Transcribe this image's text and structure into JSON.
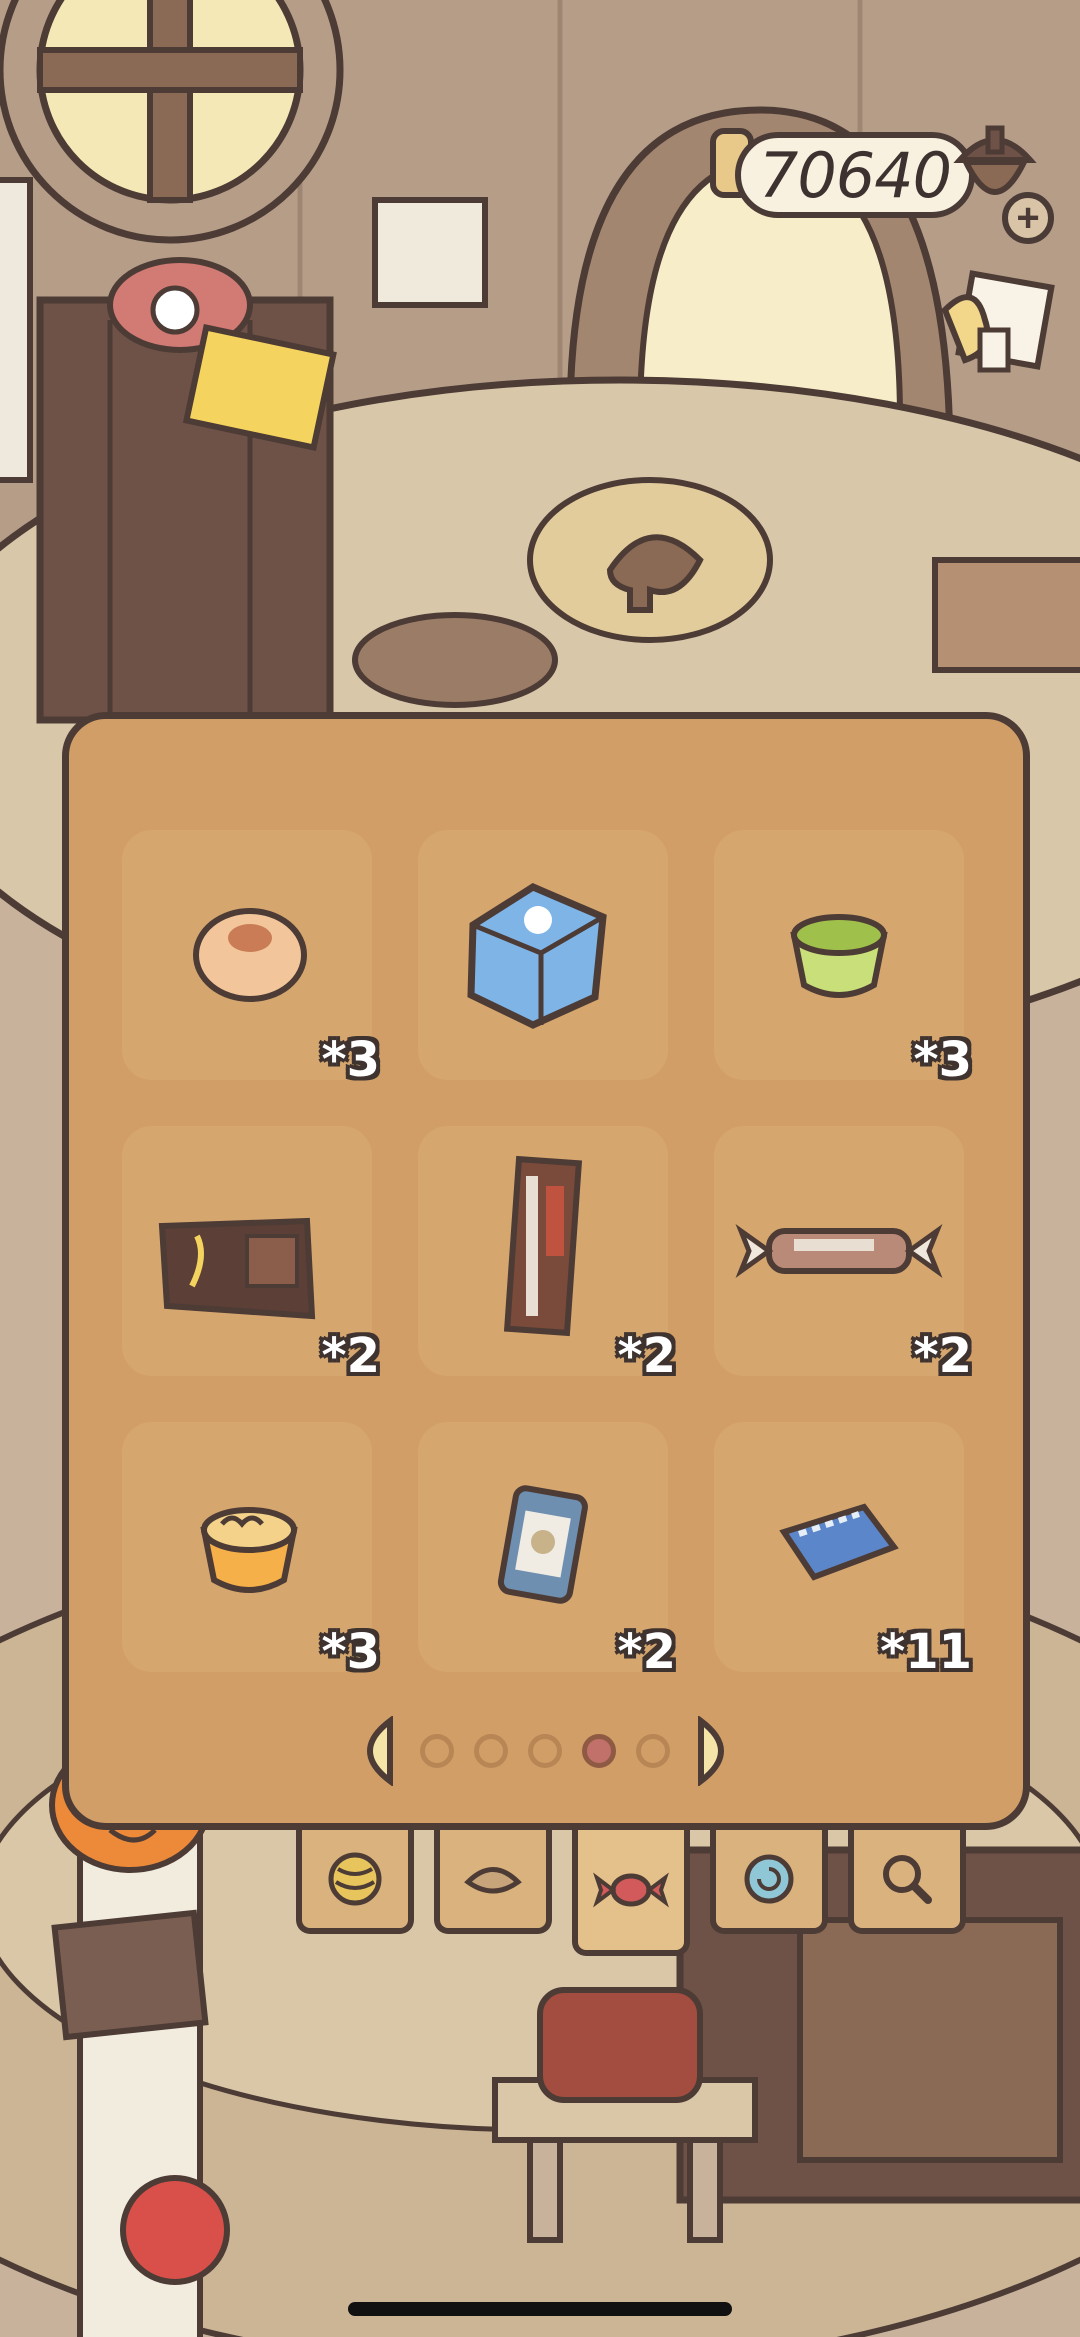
{
  "header": {
    "coins": "70640",
    "add_coins_icon": "plus-icon",
    "task_icon": "clipboard-icon"
  },
  "inventory": {
    "items": [
      {
        "name": "bun-icon",
        "count": "*3"
      },
      {
        "name": "blue-candy-box-icon",
        "count": ""
      },
      {
        "name": "green-jelly-cup-icon",
        "count": "*3"
      },
      {
        "name": "chocolate-bar-icon",
        "count": "*2"
      },
      {
        "name": "cookie-stick-box-icon",
        "count": "*2"
      },
      {
        "name": "wrapped-candy-icon",
        "count": "*2"
      },
      {
        "name": "orange-pudding-icon",
        "count": "*3"
      },
      {
        "name": "milk-carton-icon",
        "count": "*2"
      },
      {
        "name": "blue-snack-pack-icon",
        "count": "*11"
      }
    ],
    "pager": {
      "pages": 5,
      "current": 4
    }
  },
  "tabs": [
    {
      "name": "yarn-ball-icon"
    },
    {
      "name": "leaf-icon"
    },
    {
      "name": "candy-icon",
      "active": true
    },
    {
      "name": "snail-shell-icon"
    },
    {
      "name": "magnifier-icon"
    }
  ],
  "colors": {
    "panel": "#d19e67",
    "slot": "#d6a66f",
    "outline": "#4d3b35",
    "active_dot": "#c2706a"
  }
}
